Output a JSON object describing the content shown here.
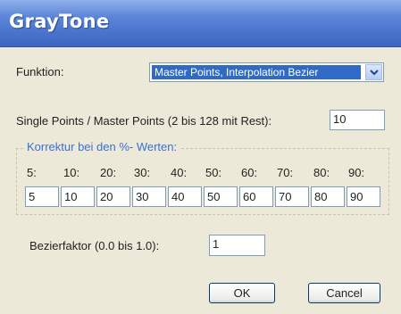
{
  "window": {
    "title": "GrayTone"
  },
  "funktion": {
    "label": "Funktion:",
    "selected": "Master Points, Interpolation Bezier"
  },
  "points": {
    "label": "Single Points / Master Points (2 bis 128 mit Rest):",
    "value": "10"
  },
  "korrektur": {
    "title": "Korrektur bei den %- Werten:",
    "labels": [
      "5:",
      "10:",
      "20:",
      "30:",
      "40:",
      "50:",
      "60:",
      "70:",
      "80:",
      "90:"
    ],
    "values": [
      "5",
      "10",
      "20",
      "30",
      "40",
      "50",
      "60",
      "70",
      "80",
      "90"
    ]
  },
  "bezier": {
    "label": "Bezierfaktor (0.0 bis 1.0):",
    "value": "1"
  },
  "buttons": {
    "ok": "OK",
    "cancel": "Cancel"
  },
  "icons": {
    "dropdown": "chevron-down-icon"
  },
  "colors": {
    "titlebar": "#4a74cc",
    "selection": "#316ac5",
    "group_title": "#3a6fd8"
  }
}
